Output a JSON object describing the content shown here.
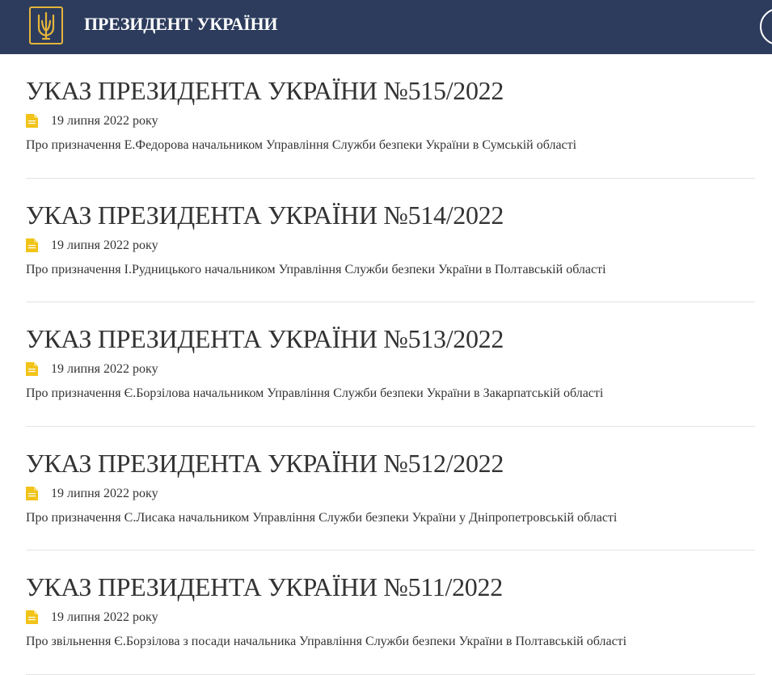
{
  "header": {
    "site_title": "ПРЕЗИДЕНТ УКРАЇНИ",
    "emblem_icon": "trident-emblem-icon",
    "background_color": "#2d3c5d",
    "accent_color": "#e4b53a"
  },
  "decrees": [
    {
      "title": "УКАЗ ПРЕЗИДЕНТА УКРАЇНИ №515/2022",
      "date": "19 липня 2022 року",
      "description": "Про призначення Е.Федорова начальником Управління Служби безпеки України в Сумській області"
    },
    {
      "title": "УКАЗ ПРЕЗИДЕНТА УКРАЇНИ №514/2022",
      "date": "19 липня 2022 року",
      "description": "Про призначення І.Рудницького начальником Управління Служби безпеки України в Полтавській області"
    },
    {
      "title": "УКАЗ ПРЕЗИДЕНТА УКРАЇНИ №513/2022",
      "date": "19 липня 2022 року",
      "description": "Про призначення Є.Борзілова начальником Управління Служби безпеки України в Закарпатській області"
    },
    {
      "title": "УКАЗ ПРЕЗИДЕНТА УКРАЇНИ №512/2022",
      "date": "19 липня 2022 року",
      "description": "Про призначення С.Лисака начальником Управління Служби безпеки України у Дніпропетровській області"
    },
    {
      "title": "УКАЗ ПРЕЗИДЕНТА УКРАЇНИ №511/2022",
      "date": "19 липня 2022 року",
      "description": "Про звільнення Є.Борзілова з посади начальника Управління Служби безпеки України в Полтавській області"
    }
  ],
  "icons": {
    "document_icon": "document-icon",
    "document_icon_color": "#f2c318"
  }
}
